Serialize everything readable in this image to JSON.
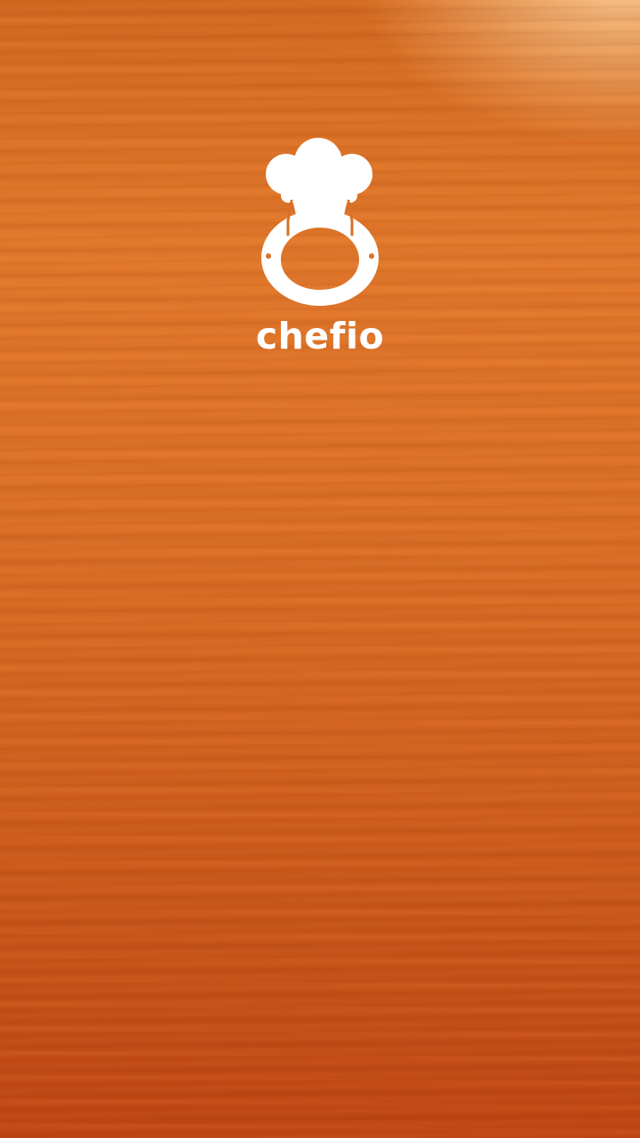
{
  "app": {
    "brand_name": "chefio",
    "logo_icon": "chef-hat-pot-icon"
  },
  "colors": {
    "background_top": "#e2772a",
    "background_bottom": "#bf4513",
    "logo": "#ffffff"
  }
}
